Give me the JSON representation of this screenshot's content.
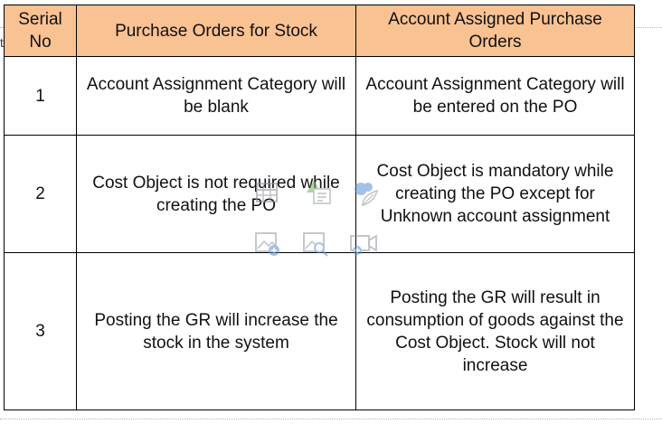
{
  "margin_mark": "t",
  "table": {
    "headers": {
      "serial": "Serial No",
      "stock": "Purchase Orders for Stock",
      "assigned": "Account Assigned Purchase Orders"
    },
    "rows": [
      {
        "serial": "1",
        "stock": "Account Assignment Category will be blank",
        "assigned": "Account Assignment Category will be entered on the PO"
      },
      {
        "serial": "2",
        "stock": "Cost Object is not required while creating the PO",
        "assigned": "Cost Object is mandatory while creating the PO except for Unknown account assignment"
      },
      {
        "serial": "3",
        "stock": "Posting the GR will increase the stock in the system",
        "assigned": "Posting the GR will result in consumption of goods against the Cost Object. Stock will not increase"
      }
    ]
  },
  "overlay_icons": [
    "insert-table-icon",
    "insert-chart-icon",
    "insert-smartart-icon",
    "insert-picture-icon",
    "insert-online-picture-icon",
    "insert-video-icon"
  ],
  "colors": {
    "header_bg": "#f9c293",
    "overlay_icon": "#8a8f99",
    "overlay_accent": "#5b8fd6"
  }
}
